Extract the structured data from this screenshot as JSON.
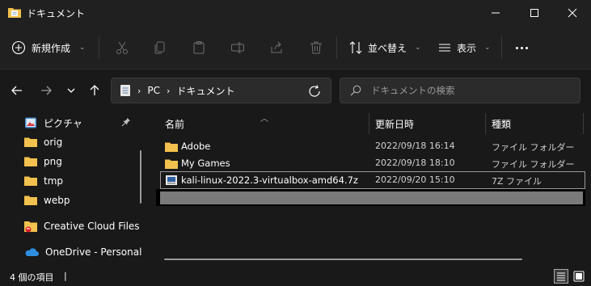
{
  "window": {
    "title": "ドキュメント"
  },
  "toolbar": {
    "new_label": "新規作成",
    "sort_label": "並べ替え",
    "view_label": "表示"
  },
  "address": {
    "parts": [
      "PC",
      "ドキュメント"
    ]
  },
  "search": {
    "placeholder": "ドキュメントの検索"
  },
  "sidebar": {
    "items": [
      {
        "label": "ピクチャ",
        "icon": "pictures-icon",
        "pinned": true
      },
      {
        "label": "orig",
        "icon": "folder-icon"
      },
      {
        "label": "png",
        "icon": "folder-icon"
      },
      {
        "label": "tmp",
        "icon": "folder-icon"
      },
      {
        "label": "webp",
        "icon": "folder-icon"
      },
      {
        "label": "Creative Cloud Files",
        "icon": "creative-cloud-icon"
      },
      {
        "label": "OneDrive - Personal",
        "icon": "onedrive-icon"
      }
    ]
  },
  "columns": {
    "name": "名前",
    "modified": "更新日時",
    "type": "種類"
  },
  "files": [
    {
      "name": "Adobe",
      "modified": "2022/09/18 16:14",
      "type": "ファイル フォルダー",
      "icon": "folder-icon"
    },
    {
      "name": "My Games",
      "modified": "2022/09/18 18:10",
      "type": "ファイル フォルダー",
      "icon": "folder-icon"
    },
    {
      "name": "kali-linux-2022.3-virtualbox-amd64.7z",
      "modified": "2022/09/20 15:10",
      "type": "7Z ファイル",
      "icon": "archive-icon"
    }
  ],
  "status": {
    "item_count": "4 個の項目"
  },
  "colors": {
    "folder": "#f2c14e",
    "background": "#191919",
    "chrome": "#202020"
  }
}
